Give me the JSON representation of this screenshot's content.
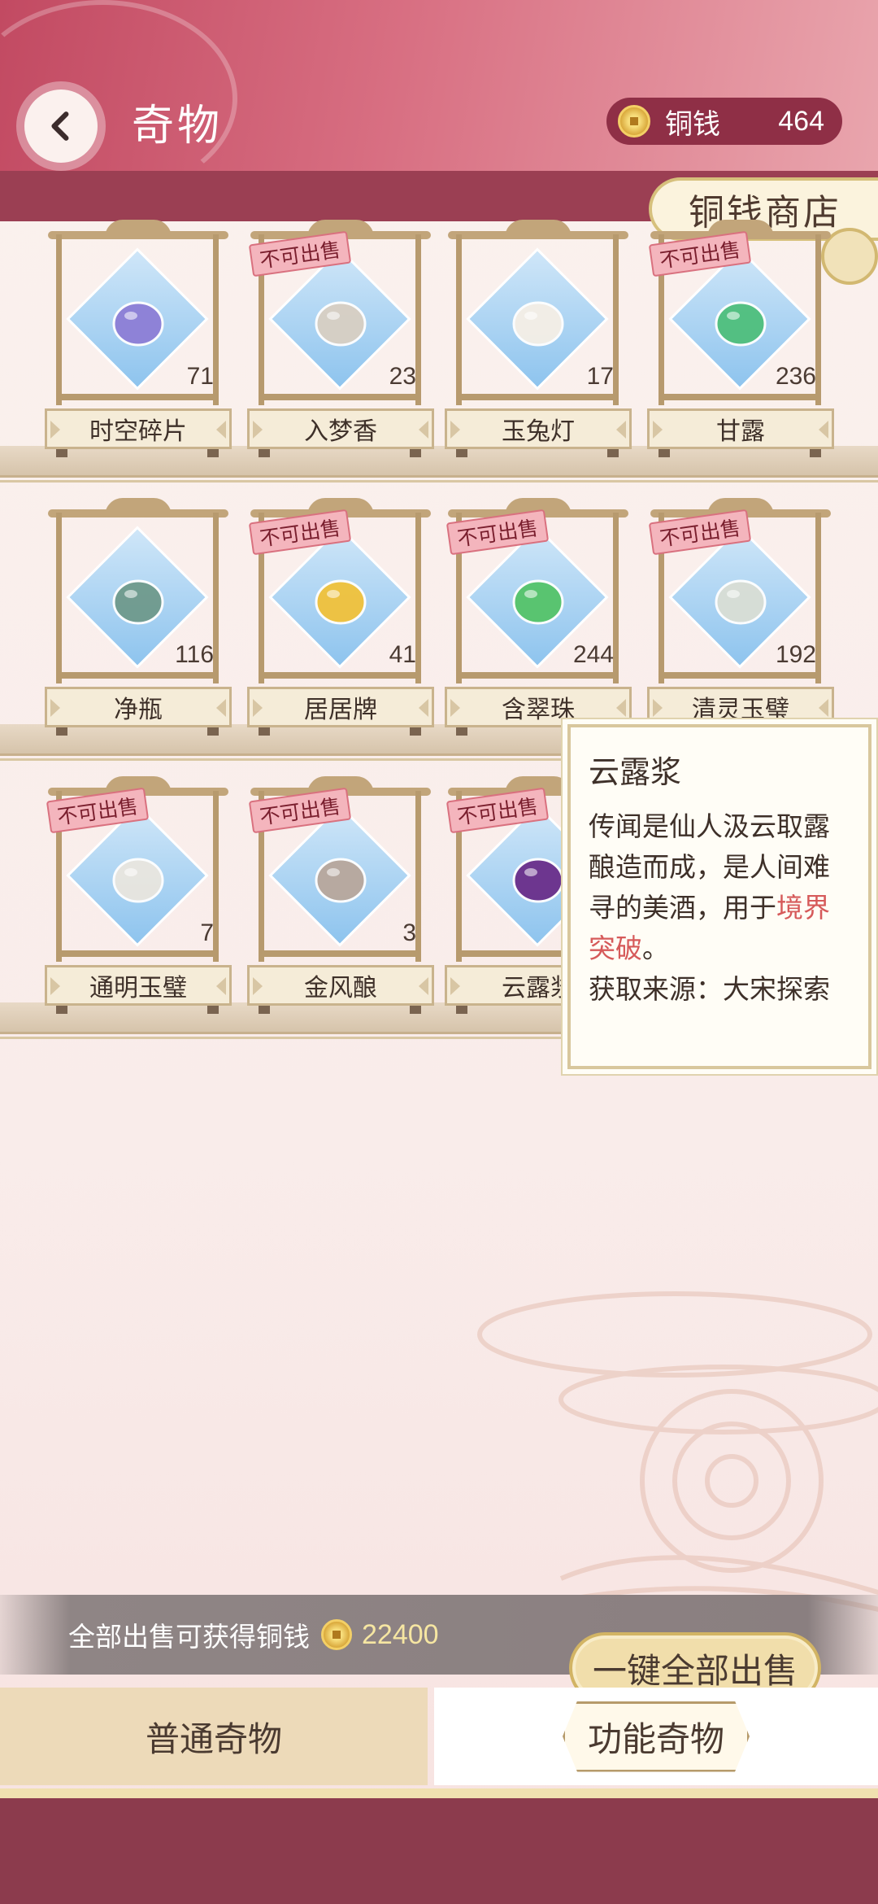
{
  "header": {
    "title": "奇物",
    "currency_label": "铜钱",
    "currency_value": "464"
  },
  "shop_tab": {
    "label": "铜钱商店"
  },
  "items": [
    {
      "name": "时空碎片",
      "count": "71",
      "tag": "",
      "art": "crystal-shards",
      "color": "#8d7ed6"
    },
    {
      "name": "入梦香",
      "count": "23",
      "tag": "不可出售",
      "art": "incense-burner",
      "color": "#d8cfc3"
    },
    {
      "name": "玉兔灯",
      "count": "17",
      "tag": "",
      "art": "rabbit-lantern",
      "color": "#f5efe6"
    },
    {
      "name": "甘露",
      "count": "236",
      "tag": "不可出售",
      "art": "dew-drop",
      "color": "#4fbf7d"
    },
    {
      "name": "净瓶",
      "count": "116",
      "tag": "",
      "art": "celadon-vase",
      "color": "#6f9a8c"
    },
    {
      "name": "居居牌",
      "count": "41",
      "tag": "不可出售",
      "art": "pig-token",
      "color": "#f1c23b"
    },
    {
      "name": "含翠珠",
      "count": "244",
      "tag": "不可出售",
      "art": "jade-pearl",
      "color": "#55c46a"
    },
    {
      "name": "清灵玉璧",
      "count": "192",
      "tag": "不可出售",
      "art": "jade-disc",
      "color": "#d9ded5"
    },
    {
      "name": "通明玉璧",
      "count": "7",
      "tag": "不可出售",
      "art": "pattern-disc",
      "color": "#e9e6df"
    },
    {
      "name": "金风酿",
      "count": "3",
      "tag": "不可出售",
      "art": "wine-gourd",
      "color": "#b8a79c"
    },
    {
      "name": "云露浆",
      "count": "",
      "tag": "不可出售",
      "art": "purple-jar",
      "color": "#6a2e8a"
    }
  ],
  "tooltip": {
    "title": "云露浆",
    "desc_before": "传闻是仙人汲云取露酿造而成，是人间难寻的美酒，用于",
    "desc_highlight": "境界突破",
    "desc_after": "。",
    "source": "获取来源：大宋探索"
  },
  "sell": {
    "text": "全部出售可获得铜钱",
    "amount": "22400",
    "button_label": "一键全部出售"
  },
  "tabs": {
    "normal_label": "普通奇物",
    "function_label": "功能奇物"
  }
}
